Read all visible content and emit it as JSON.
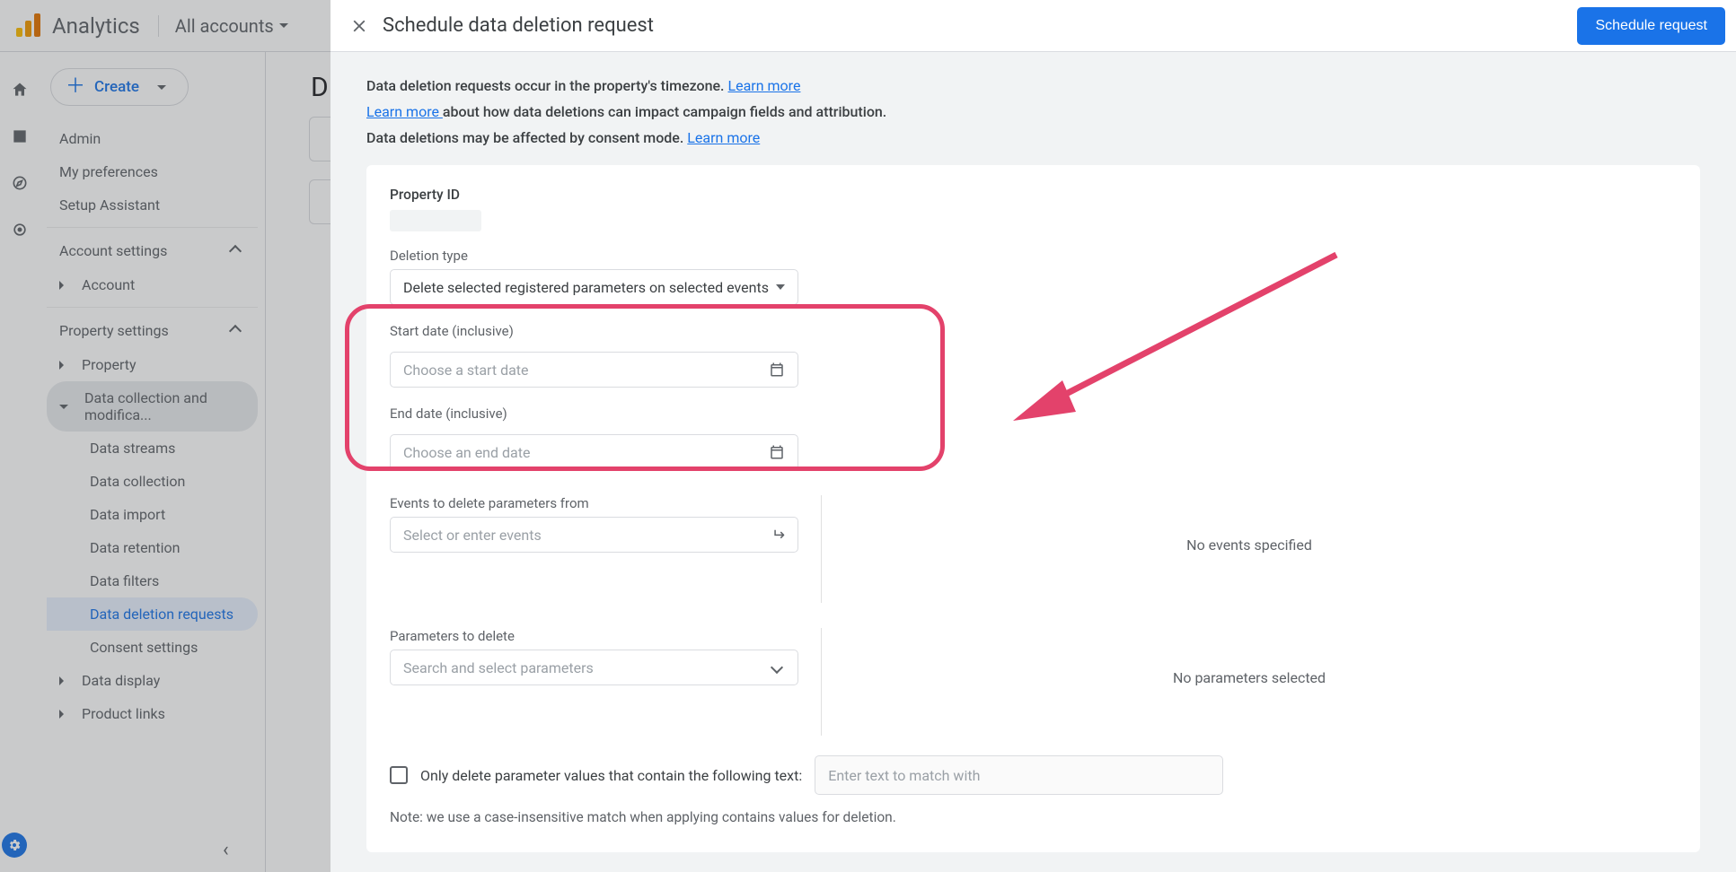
{
  "header": {
    "product": "Analytics",
    "account_picker": "All accounts"
  },
  "sidebar": {
    "create_label": "Create",
    "items": {
      "admin": "Admin",
      "prefs": "My preferences",
      "setup": "Setup Assistant"
    },
    "account_section": "Account settings",
    "account_item": "Account",
    "property_section": "Property settings",
    "property_item": "Property",
    "dcm": "Data collection and modifica...",
    "dcm_sub": {
      "streams": "Data streams",
      "collection": "Data collection",
      "import": "Data import",
      "retention": "Data retention",
      "filters": "Data filters",
      "deletion": "Data deletion requests",
      "consent": "Consent settings"
    },
    "data_display": "Data display",
    "product_links": "Product links"
  },
  "bg_main": {
    "letter": "D"
  },
  "dialog": {
    "title": "Schedule data deletion request",
    "schedule_btn": "Schedule request",
    "info1a": "Data deletion requests occur in the property's timezone. ",
    "info1_link": "Learn more",
    "info2_link": "Learn more ",
    "info2b": "about how data deletions can impact campaign fields and attribution.",
    "info3a": "Data deletions may be affected by consent mode. ",
    "info3_link": "Learn more",
    "property_id_label": "Property ID",
    "deletion_type_label": "Deletion type",
    "deletion_type_value": "Delete selected registered parameters on selected events",
    "start_label": "Start date (inclusive)",
    "start_placeholder": "Choose a start date",
    "end_label": "End date (inclusive)",
    "end_placeholder": "Choose an end date",
    "events_label": "Events to delete parameters from",
    "events_placeholder": "Select or enter events",
    "no_events": "No events specified",
    "params_label": "Parameters to delete",
    "params_placeholder": "Search and select parameters",
    "no_params": "No parameters selected",
    "checkbox_label": "Only delete parameter values that contain the following text:",
    "match_placeholder": "Enter text to match with",
    "note": "Note: we use a case-insensitive match when applying contains values for deletion."
  }
}
